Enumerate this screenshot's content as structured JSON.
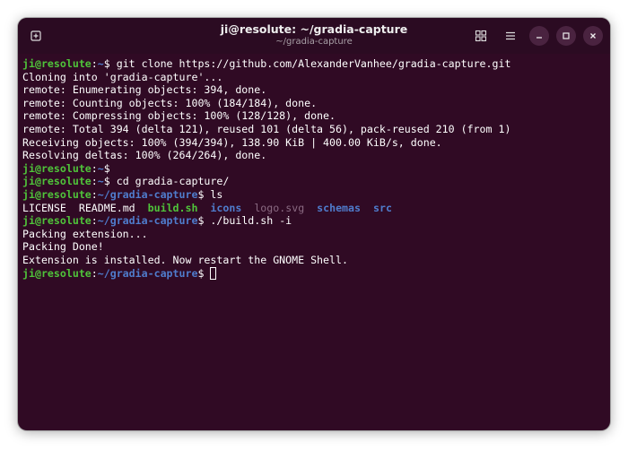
{
  "window": {
    "title": "ji@resolute: ~/gradia-capture",
    "subtitle": "~/gradia-capture"
  },
  "prompt": {
    "user_host": "ji@resolute",
    "sep": ":",
    "home": "~",
    "cwd": "~/gradia-capture",
    "symbol": "$"
  },
  "commands": {
    "clone": " git clone https://github.com/AlexanderVanhee/gradia-capture.git",
    "cd": " cd gradia-capture/",
    "ls": " ls",
    "build": " ./build.sh -i"
  },
  "output": {
    "clone": [
      "Cloning into 'gradia-capture'...",
      "remote: Enumerating objects: 394, done.",
      "remote: Counting objects: 100% (184/184), done.",
      "remote: Compressing objects: 100% (128/128), done.",
      "remote: Total 394 (delta 121), reused 101 (delta 56), pack-reused 210 (from 1)",
      "Receiving objects: 100% (394/394), 138.90 KiB | 400.00 KiB/s, done.",
      "Resolving deltas: 100% (264/264), done."
    ],
    "ls": {
      "license": "LICENSE",
      "readme": "README.md",
      "build": "build.sh",
      "icons": "icons",
      "logo": "logo.svg",
      "schemas": "schemas",
      "src": "src"
    },
    "build": [
      "Packing extension...",
      "Packing Done!",
      "Extension is installed. Now restart the GNOME Shell."
    ]
  },
  "colors": {
    "terminal_bg": "#300a24",
    "prompt_user": "#4fc43a",
    "prompt_path": "#4f7ccc",
    "executable": "#4fc43a",
    "directory": "#4f7ccc",
    "image_file": "#8a6a82"
  },
  "icons": {
    "new_tab": "new-tab-icon",
    "view": "grid-view-icon",
    "menu": "hamburger-menu-icon",
    "minimize": "minimize-icon",
    "maximize": "maximize-icon",
    "close": "close-icon"
  }
}
